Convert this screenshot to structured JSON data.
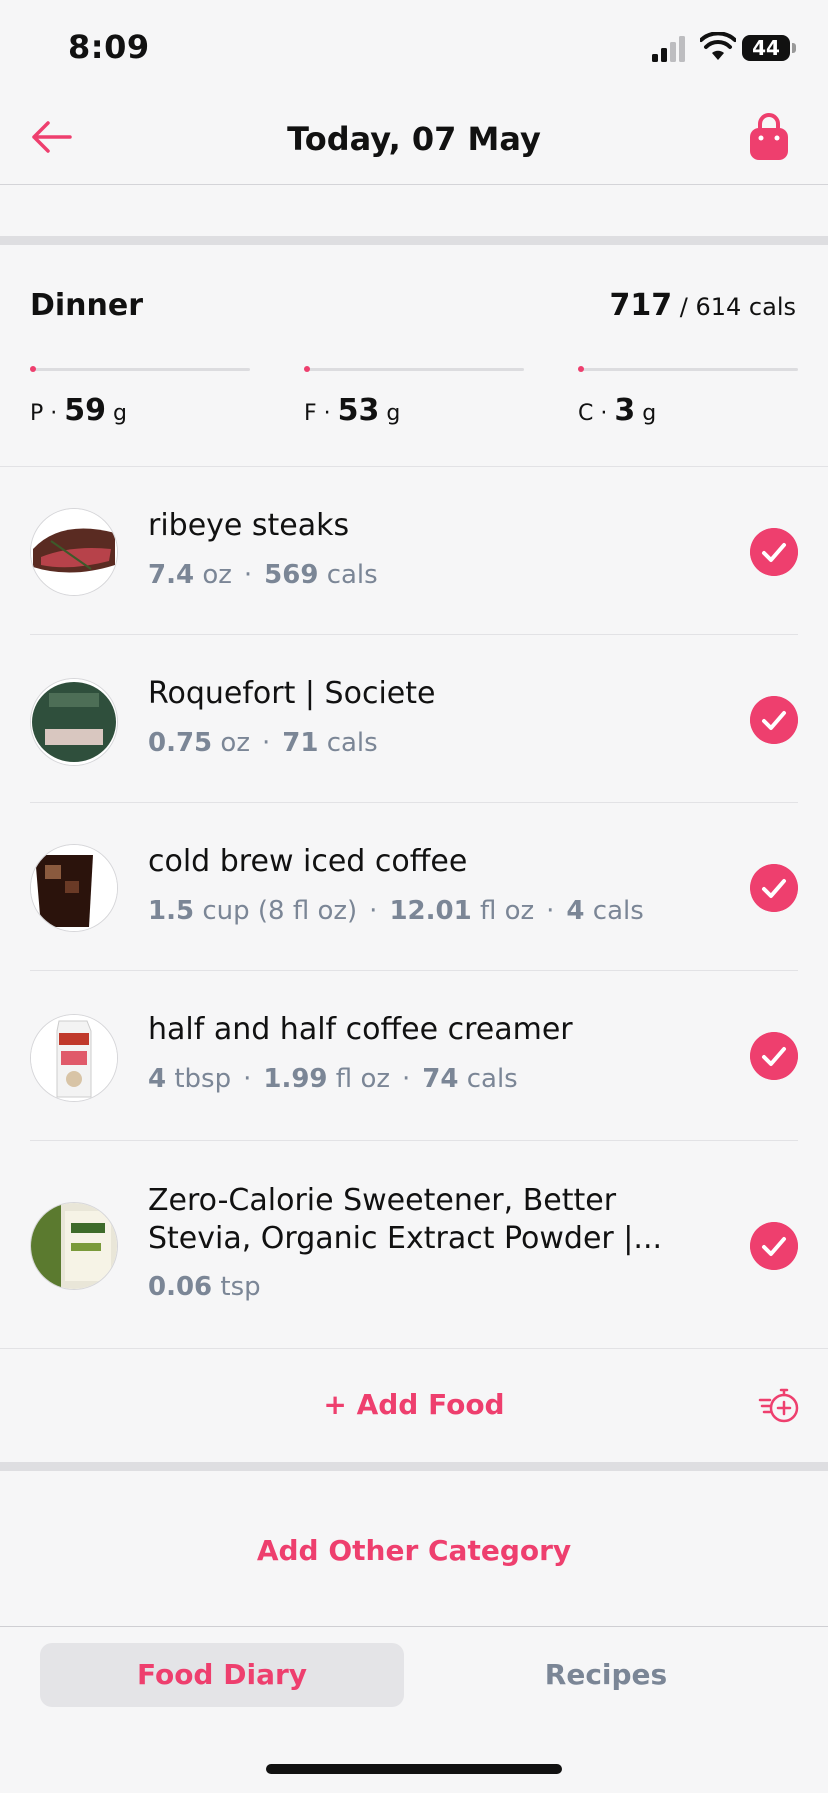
{
  "status": {
    "time": "8:09",
    "battery": "44"
  },
  "nav": {
    "title": "Today, 07 May",
    "back_icon": "arrow-left-icon",
    "bag_icon": "shopping-bag-icon"
  },
  "meal": {
    "title": "Dinner",
    "cals_consumed": "717",
    "cals_target": "/ 614 cals",
    "macros": [
      {
        "letter": "P",
        "value": "59",
        "unit": "g"
      },
      {
        "letter": "F",
        "value": "53",
        "unit": "g"
      },
      {
        "letter": "C",
        "value": "3",
        "unit": "g"
      }
    ]
  },
  "foods": [
    {
      "name": "ribeye steaks",
      "meta": [
        {
          "v": "7.4",
          "u": "oz"
        },
        {
          "v": "569",
          "u": "cals"
        }
      ]
    },
    {
      "name": "Roquefort | Societe",
      "meta": [
        {
          "v": "0.75",
          "u": "oz"
        },
        {
          "v": "71",
          "u": "cals"
        }
      ]
    },
    {
      "name": "cold brew iced coffee",
      "meta": [
        {
          "v": "1.5",
          "u": "cup (8 fl oz)"
        },
        {
          "v": "12.01",
          "u": "fl oz"
        },
        {
          "v": "4",
          "u": "cals"
        }
      ]
    },
    {
      "name": "half and half coffee creamer",
      "meta": [
        {
          "v": "4",
          "u": "tbsp"
        },
        {
          "v": "1.99",
          "u": "fl oz"
        },
        {
          "v": "74",
          "u": "cals"
        }
      ]
    },
    {
      "name": "Zero-Calorie Sweetener, Better Stevia, Organic Extract Powder |...",
      "meta": [
        {
          "v": "0.06",
          "u": "tsp"
        }
      ]
    }
  ],
  "actions": {
    "add_food": "+ Add Food",
    "add_category": "Add Other Category"
  },
  "tabs": {
    "food_diary": "Food Diary",
    "recipes": "Recipes"
  },
  "colors": {
    "accent": "#ee3f6e",
    "muted": "#7b8696"
  }
}
